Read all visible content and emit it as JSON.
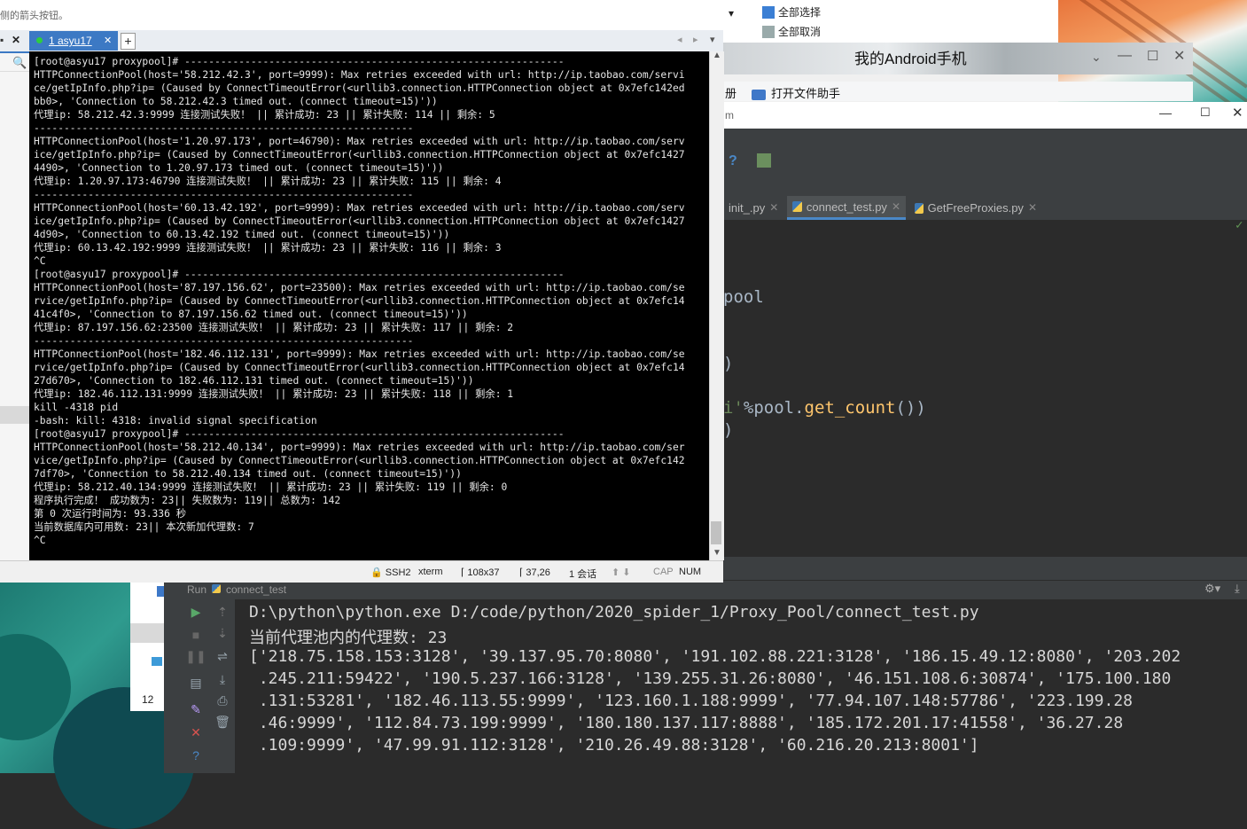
{
  "xshell": {
    "hint": "侧的箭头按钮。",
    "tab_label": "1 asyu17",
    "tab_add": "+",
    "close_left": "✕",
    "terminal_lines": [
      "[root@asyu17 proxypool]# ---------------------------------------------------------------",
      "HTTPConnectionPool(host='58.212.42.3', port=9999): Max retries exceeded with url: http://ip.taobao.com/servi",
      "ce/getIpInfo.php?ip= (Caused by ConnectTimeoutError(<urllib3.connection.HTTPConnection object at 0x7efc142ed",
      "bb0>, 'Connection to 58.212.42.3 timed out. (connect timeout=15)'))",
      "代理ip: 58.212.42.3:9999 连接测试失败！ || 累计成功: 23 || 累计失败: 114 || 剩余: 5",
      "---------------------------------------------------------------",
      "HTTPConnectionPool(host='1.20.97.173', port=46790): Max retries exceeded with url: http://ip.taobao.com/serv",
      "ice/getIpInfo.php?ip= (Caused by ConnectTimeoutError(<urllib3.connection.HTTPConnection object at 0x7efc1427",
      "4490>, 'Connection to 1.20.97.173 timed out. (connect timeout=15)'))",
      "代理ip: 1.20.97.173:46790 连接测试失败！ || 累计成功: 23 || 累计失败: 115 || 剩余: 4",
      "---------------------------------------------------------------",
      "HTTPConnectionPool(host='60.13.42.192', port=9999): Max retries exceeded with url: http://ip.taobao.com/serv",
      "ice/getIpInfo.php?ip= (Caused by ConnectTimeoutError(<urllib3.connection.HTTPConnection object at 0x7efc1427",
      "4d90>, 'Connection to 60.13.42.192 timed out. (connect timeout=15)'))",
      "代理ip: 60.13.42.192:9999 连接测试失败！ || 累计成功: 23 || 累计失败: 116 || 剩余: 3",
      "^C",
      "[root@asyu17 proxypool]# ---------------------------------------------------------------",
      "HTTPConnectionPool(host='87.197.156.62', port=23500): Max retries exceeded with url: http://ip.taobao.com/se",
      "rvice/getIpInfo.php?ip= (Caused by ConnectTimeoutError(<urllib3.connection.HTTPConnection object at 0x7efc14",
      "41c4f0>, 'Connection to 87.197.156.62 timed out. (connect timeout=15)'))",
      "代理ip: 87.197.156.62:23500 连接测试失败！ || 累计成功: 23 || 累计失败: 117 || 剩余: 2",
      "---------------------------------------------------------------",
      "HTTPConnectionPool(host='182.46.112.131', port=9999): Max retries exceeded with url: http://ip.taobao.com/se",
      "rvice/getIpInfo.php?ip= (Caused by ConnectTimeoutError(<urllib3.connection.HTTPConnection object at 0x7efc14",
      "27d670>, 'Connection to 182.46.112.131 timed out. (connect timeout=15)'))",
      "代理ip: 182.46.112.131:9999 连接测试失败！ || 累计成功: 23 || 累计失败: 118 || 剩余: 1",
      "kill -4318 pid",
      "-bash: kill: 4318: invalid signal specification",
      "[root@asyu17 proxypool]# ---------------------------------------------------------------",
      "HTTPConnectionPool(host='58.212.40.134', port=9999): Max retries exceeded with url: http://ip.taobao.com/ser",
      "vice/getIpInfo.php?ip= (Caused by ConnectTimeoutError(<urllib3.connection.HTTPConnection object at 0x7efc142",
      "7df70>, 'Connection to 58.212.40.134 timed out. (connect timeout=15)'))",
      "代理ip: 58.212.40.134:9999 连接测试失败！ || 累计成功: 23 || 累计失败: 119 || 剩余: 0",
      "程序执行完成！ 成功数为: 23|| 失败数为: 119|| 总数为: 142",
      "第 0 次运行时间为: 93.336 秒",
      "当前数据库内可用数: 23|| 本次新加代理数: 7",
      "^C"
    ],
    "status": {
      "ssh": "SSH2",
      "term": "xterm",
      "size": "108x37",
      "pos": "37,26",
      "sessions": "1 会话",
      "cap": "CAP",
      "num": "NUM"
    }
  },
  "explorer": {
    "select_all": "全部选择",
    "deselect_all": "全部取消"
  },
  "browser": {
    "android_title": "我的Android手机",
    "bookmark_partial": "册",
    "bookmark_folder": "打开文件助手"
  },
  "pycharm": {
    "title_partial": "m",
    "tabs": [
      "init_.py",
      "connect_test.py",
      "GetFreeProxies.py"
    ],
    "code": {
      "l1": "pool",
      "l2": ")",
      "l3_a": "i'",
      "l3_b": "%pool.",
      "l3_c": "get_count",
      "l3_d": "())",
      "l4": ")"
    },
    "run": {
      "label": "Run",
      "config": "connect_test",
      "output": [
        "D:\\python\\python.exe D:/code/python/2020_spider_1/Proxy_Pool/connect_test.py",
        "当前代理池内的代理数: 23",
        "['218.75.158.153:3128', '39.137.95.70:8080', '191.102.88.221:3128', '186.15.49.12:8080', '203.202",
        " .245.211:59422', '190.5.237.166:3128', '139.255.31.26:8080', '46.151.108.6:30874', '175.100.180",
        " .131:53281', '182.46.113.55:9999', '123.160.1.188:9999', '77.94.107.148:57786', '223.199.28",
        " .46:9999', '112.84.73.199:9999', '180.180.137.117:8888', '185.172.201.17:41558', '36.27.28",
        " .109:9999', '47.99.91.112:3128', '210.26.49.88:3128', '60.216.20.213:8001']"
      ]
    }
  },
  "desktop": {
    "card_number": "12"
  },
  "colors": {
    "terminal_bg": "#000000",
    "xshell_accent": "#3c79c4",
    "ide_bg": "#2b2b2b",
    "ide_panel": "#3c3f41",
    "keyword_purple": "#cc7832",
    "string_green": "#6a8759",
    "func_yellow": "#ffc66d",
    "magenta": "#9876aa"
  }
}
